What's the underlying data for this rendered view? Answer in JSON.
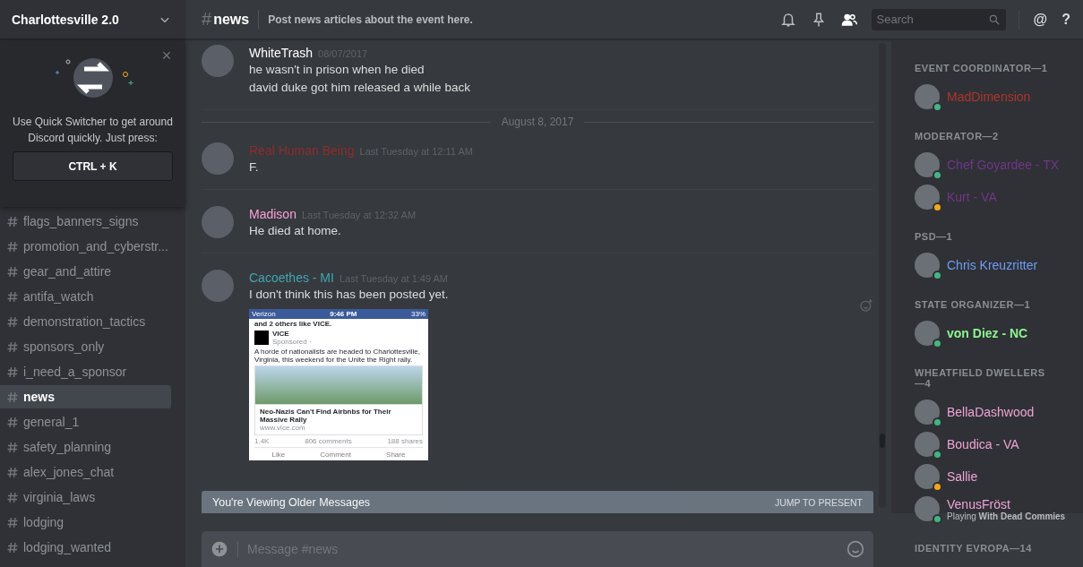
{
  "server": {
    "name": "Charlottesville 2.0"
  },
  "quick_switcher": {
    "close": "×",
    "message": "Use Quick Switcher to get around Discord quickly. Just press:",
    "shortcut": "CTRL + K"
  },
  "channels": [
    {
      "name": "flags_banners_signs",
      "selected": false
    },
    {
      "name": "promotion_and_cyberstr...",
      "selected": false
    },
    {
      "name": "gear_and_attire",
      "selected": false
    },
    {
      "name": "antifa_watch",
      "selected": false
    },
    {
      "name": "demonstration_tactics",
      "selected": false
    },
    {
      "name": "sponsors_only",
      "selected": false
    },
    {
      "name": "i_need_a_sponsor",
      "selected": false
    },
    {
      "name": "news",
      "selected": true
    },
    {
      "name": "general_1",
      "selected": false
    },
    {
      "name": "safety_planning",
      "selected": false
    },
    {
      "name": "alex_jones_chat",
      "selected": false
    },
    {
      "name": "virginia_laws",
      "selected": false
    },
    {
      "name": "lodging",
      "selected": false
    },
    {
      "name": "lodging_wanted",
      "selected": false
    }
  ],
  "header": {
    "hash": "#",
    "channel": "news",
    "topic": "Post news articles about the event here.",
    "search_placeholder": "Search",
    "mention": "@",
    "help": "?"
  },
  "messages": [
    {
      "kind": "message",
      "author": "WhiteTrash",
      "color": "#ffffff",
      "time": "08/07/2017",
      "lines": [
        "he wasn't in prison when he died",
        "david duke got him released a while back"
      ]
    },
    {
      "kind": "divider",
      "label": "August 8, 2017"
    },
    {
      "kind": "message",
      "author": "Real Human Being",
      "color": "#8f2c2c",
      "time": "Last Tuesday at 12:11 AM",
      "lines": [
        "F."
      ]
    },
    {
      "kind": "message",
      "author": "Madison",
      "color": "#f7a1d8",
      "time": "Last Tuesday at 12:32 AM",
      "lines": [
        "He died at home."
      ]
    },
    {
      "kind": "message",
      "author": "Cacoethes - MI",
      "color": "#3fa7b1",
      "time": "Last Tuesday at 1:49 AM",
      "lines": [
        "I don't think this has been posted yet."
      ],
      "attachment": {
        "carrier": "Verizon",
        "clock": "9:46 PM",
        "battery": "33%",
        "likes_line": "and 2 others like VICE.",
        "page": "VICE",
        "sponsored": "Sponsored ·",
        "text": "A horde of nationalists are headed to Charlottesville, Virginia, this weekend for the Unite the Right rally.",
        "headline": "Neo-Nazis Can't Find Airbnbs for Their Massive Rally",
        "domain": "www.vice.com",
        "reactions": "1.4K",
        "comments": "806 comments",
        "shares": "188 shares",
        "actions": [
          "Like",
          "Comment",
          "Share"
        ]
      }
    }
  ],
  "older_banner": {
    "label": "You're Viewing Older Messages",
    "action": "JUMP TO PRESENT"
  },
  "composer": {
    "placeholder": "Message #news"
  },
  "member_groups": [
    {
      "title": "EVENT COORDINATOR—1",
      "members": [
        {
          "name": "MadDimension",
          "color": "#b0352b",
          "idle": false
        }
      ]
    },
    {
      "title": "MODERATOR—2",
      "members": [
        {
          "name": "Chef Goyardee - TX",
          "color": "#71368a",
          "idle": false
        },
        {
          "name": "Kurt - VA",
          "color": "#71368a",
          "idle": true
        }
      ]
    },
    {
      "title": "PSD—1",
      "members": [
        {
          "name": "Chris Kreuzritter",
          "color": "#6f9cf3",
          "idle": false
        }
      ]
    },
    {
      "title": "STATE ORGANIZER—1",
      "members": [
        {
          "name": "von Diez - NC",
          "color": "#8ef58e",
          "idle": false,
          "bold": true
        }
      ]
    },
    {
      "title": "WHEATFIELD DWELLERS—4",
      "members": [
        {
          "name": "BellaDashwood",
          "color": "#f0a3d6",
          "idle": false
        },
        {
          "name": "Boudica - VA",
          "color": "#f0a3d6",
          "idle": false
        },
        {
          "name": "Sallie",
          "color": "#f0a3d6",
          "idle": true
        },
        {
          "name": "VenusFröst",
          "color": "#f0a3d6",
          "idle": false,
          "activity_prefix": "Playing",
          "activity": "With Dead Commies"
        }
      ]
    },
    {
      "title": "IDENTITY EVROPA—14"
    }
  ]
}
